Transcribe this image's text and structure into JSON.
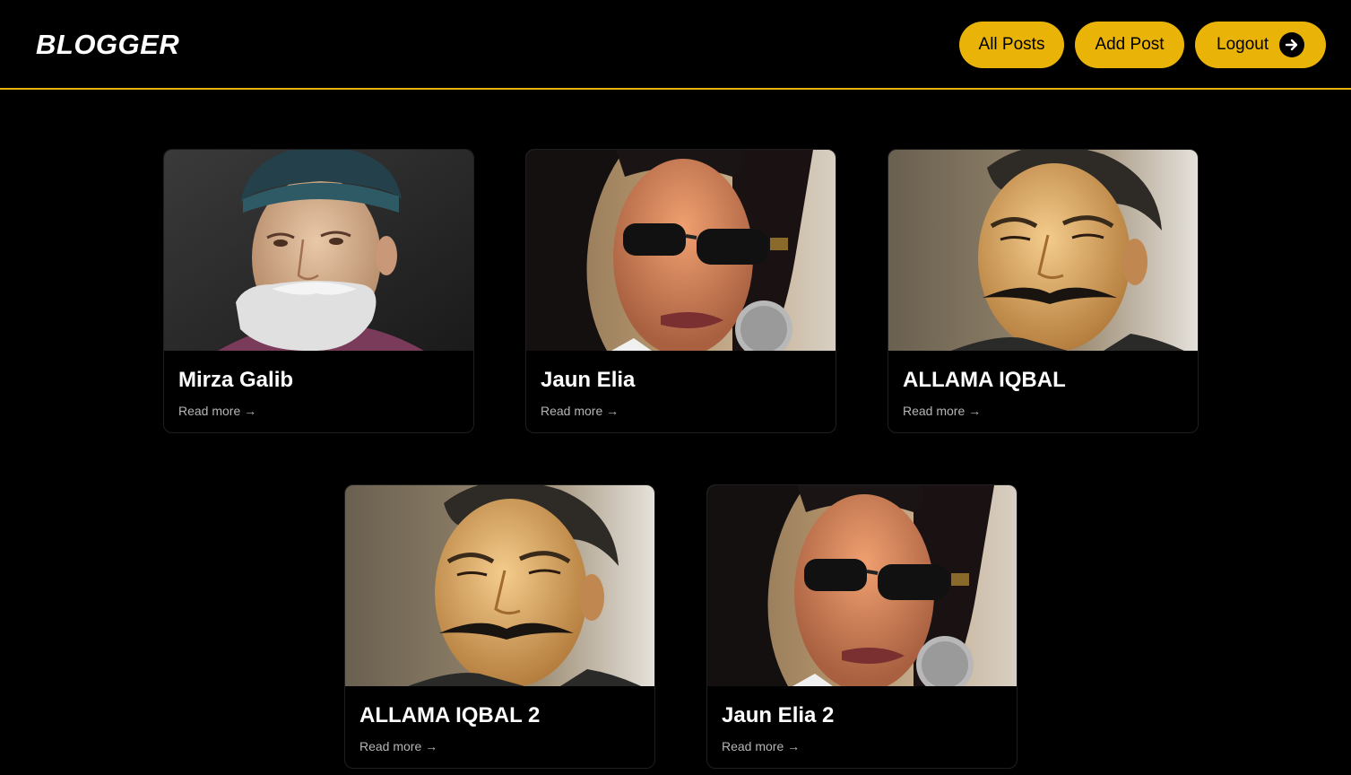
{
  "header": {
    "brand": "BLOGGER",
    "nav": {
      "all_posts": "All Posts",
      "add_post": "Add Post",
      "logout": "Logout"
    },
    "accent_color": "#eab308"
  },
  "posts": [
    {
      "title": "Mirza Galib",
      "read_more": "Read more →",
      "image": "portrait-bearded-man-cap"
    },
    {
      "title": "Jaun Elia",
      "read_more": "Read more →",
      "image": "portrait-man-sunglasses-microphone"
    },
    {
      "title": "ALLAMA IQBAL",
      "read_more": "Read more →",
      "image": "portrait-man-mustache"
    },
    {
      "title": "ALLAMA IQBAL 2",
      "read_more": "Read more →",
      "image": "portrait-man-mustache"
    },
    {
      "title": "Jaun Elia 2",
      "read_more": "Read more →",
      "image": "portrait-man-sunglasses-microphone"
    }
  ]
}
